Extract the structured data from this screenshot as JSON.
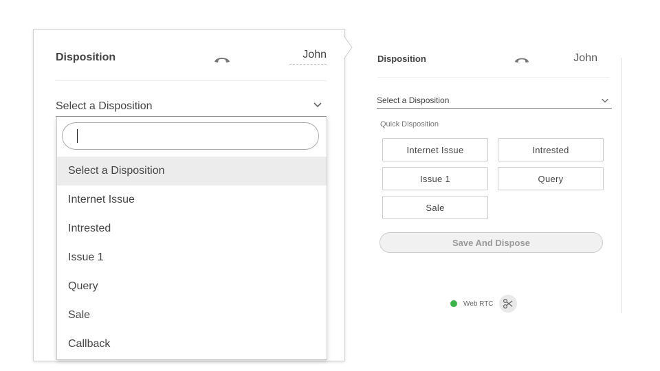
{
  "left_panel": {
    "title": "Disposition",
    "caller_name": "John",
    "select_value": "Select a Disposition",
    "search_value": "",
    "options": [
      "Select a Disposition",
      "Internet Issue",
      "Intrested",
      "Issue 1",
      "Query",
      "Sale",
      "Callback"
    ],
    "active_option_index": 0
  },
  "right_panel": {
    "title": "Disposition",
    "caller_name": "John",
    "select_value": "Select a Disposition",
    "quick_label": "Quick Disposition",
    "quick_buttons": [
      "Internet Issue",
      "Intrested",
      "Issue 1",
      "Query",
      "Sale"
    ],
    "save_label": "Save And Dispose",
    "status_text": "Web RTC",
    "status_color": "#3bb34a"
  },
  "icons": {
    "hangup": "phone-hangup-icon",
    "chevron": "chevron-down-icon",
    "tools": "scissors-icon"
  }
}
